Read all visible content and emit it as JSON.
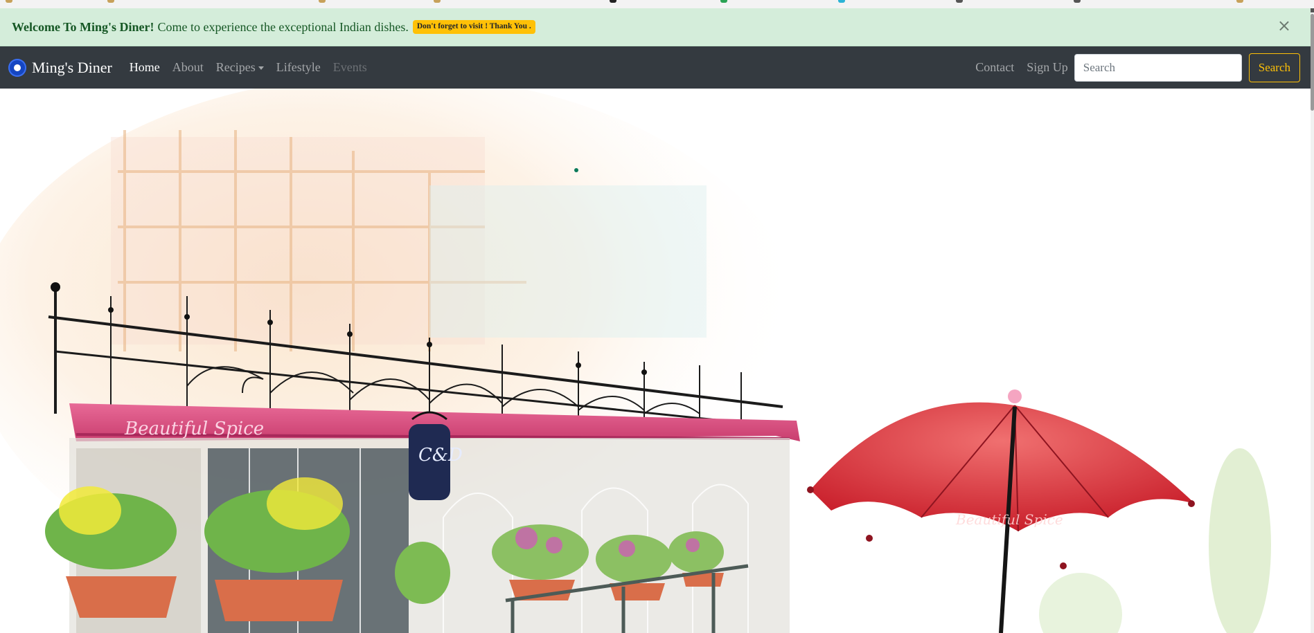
{
  "alert": {
    "title": "Welcome To Ming's Diner!",
    "message": "Come to experience the exceptional Indian dishes.",
    "badge": "Don't forget to visit ! Thank You .",
    "close": "×"
  },
  "navbar": {
    "brand": "Ming's Diner",
    "items": [
      {
        "label": "Home",
        "state": "active"
      },
      {
        "label": "About",
        "state": "normal"
      },
      {
        "label": "Recipes",
        "state": "dropdown"
      },
      {
        "label": "Lifestyle",
        "state": "normal"
      },
      {
        "label": "Events",
        "state": "disabled"
      }
    ],
    "right_items": [
      {
        "label": "Contact"
      },
      {
        "label": "Sign Up"
      }
    ],
    "search": {
      "placeholder": "Search",
      "button": "Search"
    }
  },
  "hero": {
    "awning_text": "Beautiful Spice",
    "sign_text": "C&D",
    "umbrella_text": "Beautiful Spice"
  },
  "colors": {
    "alert_bg": "#d4edda",
    "alert_text": "#155724",
    "badge": "#ffc107",
    "navbar_bg": "#343a40",
    "awning": "#d9487a",
    "umbrella": "#d92b2b"
  }
}
